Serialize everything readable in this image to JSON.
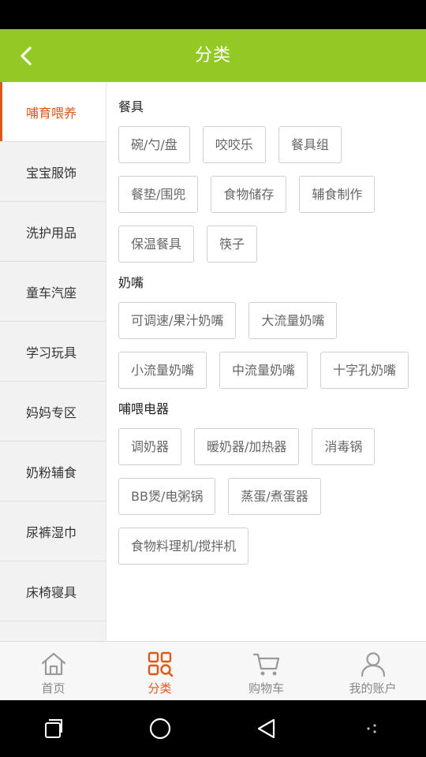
{
  "header": {
    "title": "分类"
  },
  "sidebar": {
    "items": [
      {
        "label": "哺育喂养",
        "active": true
      },
      {
        "label": "宝宝服饰"
      },
      {
        "label": "洗护用品"
      },
      {
        "label": "童车汽座"
      },
      {
        "label": "学习玩具"
      },
      {
        "label": "妈妈专区"
      },
      {
        "label": "奶粉辅食"
      },
      {
        "label": "尿裤湿巾"
      },
      {
        "label": "床椅寝具"
      }
    ]
  },
  "content": {
    "sections": [
      {
        "title": "餐具",
        "tags": [
          "碗/勺/盘",
          "咬咬乐",
          "餐具组",
          "餐垫/围兜",
          "食物储存",
          "辅食制作",
          "保温餐具",
          "筷子"
        ]
      },
      {
        "title": "奶嘴",
        "tags": [
          "可调速/果汁奶嘴",
          "大流量奶嘴",
          "小流量奶嘴",
          "中流量奶嘴",
          "十字孔奶嘴"
        ]
      },
      {
        "title": "哺喂电器",
        "tags": [
          "调奶器",
          "暖奶器/加热器",
          "消毒锅",
          "BB煲/电粥锅",
          "蒸蛋/煮蛋器",
          "食物料理机/搅拌机"
        ]
      }
    ]
  },
  "tabbar": {
    "tabs": [
      {
        "label": "首页",
        "icon": "home-icon"
      },
      {
        "label": "分类",
        "icon": "category-icon",
        "active": true
      },
      {
        "label": "购物车",
        "icon": "cart-icon"
      },
      {
        "label": "我的账户",
        "icon": "account-icon"
      }
    ]
  },
  "colors": {
    "header": "#92c924",
    "accent": "#e0571a"
  }
}
